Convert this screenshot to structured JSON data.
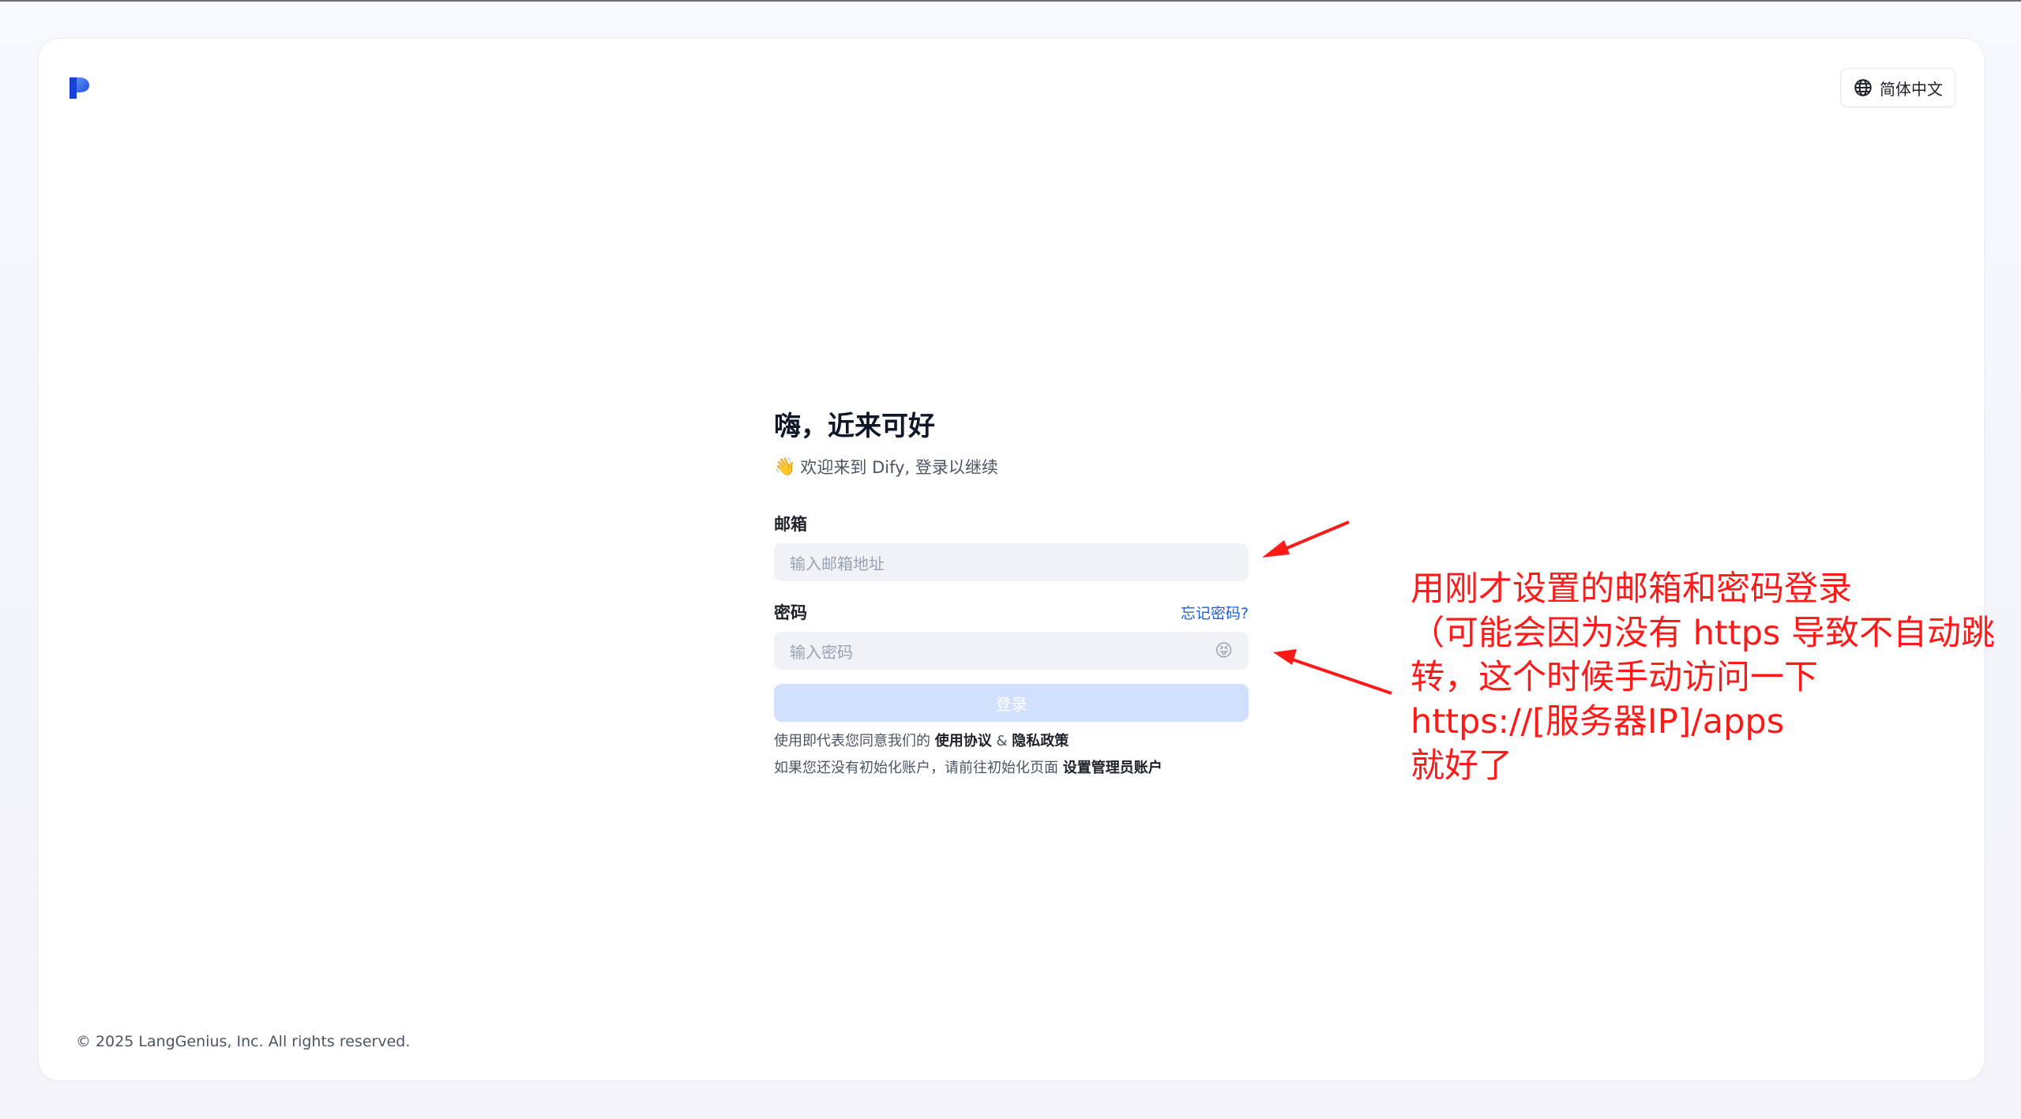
{
  "header": {
    "language_label": "简体中文"
  },
  "login": {
    "title": "嗨，近来可好",
    "subtitle_emoji": "👋",
    "subtitle": "欢迎来到 Dify, 登录以继续",
    "email_label": "邮箱",
    "email_placeholder": "输入邮箱地址",
    "password_label": "密码",
    "forgot_password": "忘记密码?",
    "password_placeholder": "输入密码",
    "password_toggle_emoji": "😝",
    "submit_label": "登录",
    "terms_prefix": "使用即代表您同意我们的",
    "terms_link": "使用协议",
    "terms_and": "&",
    "privacy_link": "隐私政策",
    "init_prefix": "如果您还没有初始化账户，请前往初始化页面",
    "init_link": "设置管理员账户"
  },
  "footer": {
    "copyright": "© 2025 LangGenius, Inc. All rights reserved."
  },
  "annotation": {
    "lines": [
      "用刚才设置的邮箱和密码登录",
      "（可能会因为没有 https 导致不自动跳",
      "转，这个时候手动访问一下",
      "https://[服务器IP]/apps",
      "就好了"
    ],
    "color": "#ff1a1a"
  },
  "colors": {
    "accent": "#1e5fdc",
    "button_disabled": "#d1e0fd"
  }
}
